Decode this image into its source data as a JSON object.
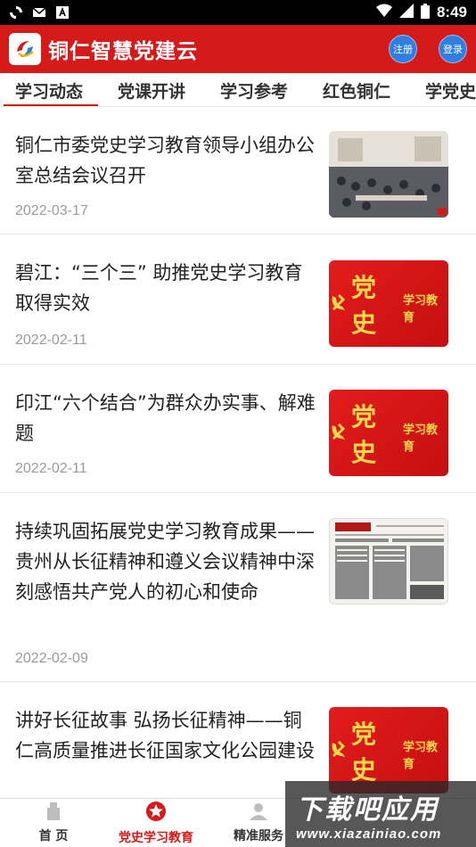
{
  "status_bar": {
    "time": "8:49",
    "icons_left": [
      "sync-icon",
      "mail-icon",
      "text-app-icon"
    ],
    "icons_right": [
      "wifi-icon",
      "signal-icon",
      "battery-icon"
    ]
  },
  "header": {
    "title": "铜仁智慧党建云",
    "register_label": "注册",
    "login_label": "登录",
    "brand_color": "#d51a1a",
    "button_color": "#2f7fe3"
  },
  "tabs": [
    {
      "label": "学习动态",
      "active": true
    },
    {
      "label": "党课开讲",
      "active": false
    },
    {
      "label": "学习参考",
      "active": false
    },
    {
      "label": "红色铜仁",
      "active": false
    },
    {
      "label": "学党史",
      "active": false
    }
  ],
  "news": [
    {
      "title": "铜仁市委党史学习教育领导小组办公室总结会议召开",
      "date": "2022-03-17",
      "thumb": "photo"
    },
    {
      "title": "碧江：“三个三” 助推党史学习教育取得实效",
      "date": "2022-02-11",
      "thumb": "party-history",
      "thumb_big": "党史",
      "thumb_small": "学习教育"
    },
    {
      "title": "印江“六个结合”为群众办实事、解难题",
      "date": "2022-02-11",
      "thumb": "party-history",
      "thumb_big": "党史",
      "thumb_small": "学习教育"
    },
    {
      "title": "持续巩固拓展党史学习教育成果——贵州从长征精神和遵义会议精神中深刻感悟共产党人的初心和使命",
      "date": "2022-02-09",
      "thumb": "newspaper"
    },
    {
      "title": "讲好长征故事 弘扬长征精神——铜仁高质量推进长征国家文化公园建设",
      "date": "",
      "thumb": "party-history",
      "thumb_big": "党史",
      "thumb_small": "学习教育"
    }
  ],
  "bottom_nav": [
    {
      "label": "首 页",
      "icon": "home-icon",
      "active": false
    },
    {
      "label": "党史学习教育",
      "icon": "star-badge-icon",
      "active": true
    },
    {
      "label": "精准服务",
      "icon": "person-icon",
      "active": false
    }
  ],
  "watermark": {
    "main": "下载吧应用",
    "url": "www.xiazainiao.com"
  }
}
